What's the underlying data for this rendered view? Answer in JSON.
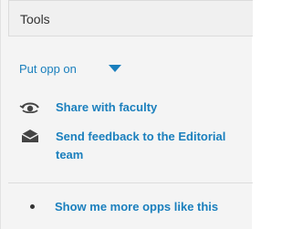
{
  "header": {
    "title": "Tools"
  },
  "put_opp": {
    "label": "Put opp on",
    "icon": "caret-down-icon"
  },
  "actions": [
    {
      "label": "Share with faculty",
      "icon": "share-eye-icon"
    },
    {
      "label": "Send feedback to the Editorial team",
      "icon": "envelope-icon"
    }
  ],
  "more": {
    "label": "Show me more opps like this"
  },
  "colors": {
    "link": "#1a7fbd",
    "text": "#333333",
    "panel_bg": "#f4f4f4"
  }
}
